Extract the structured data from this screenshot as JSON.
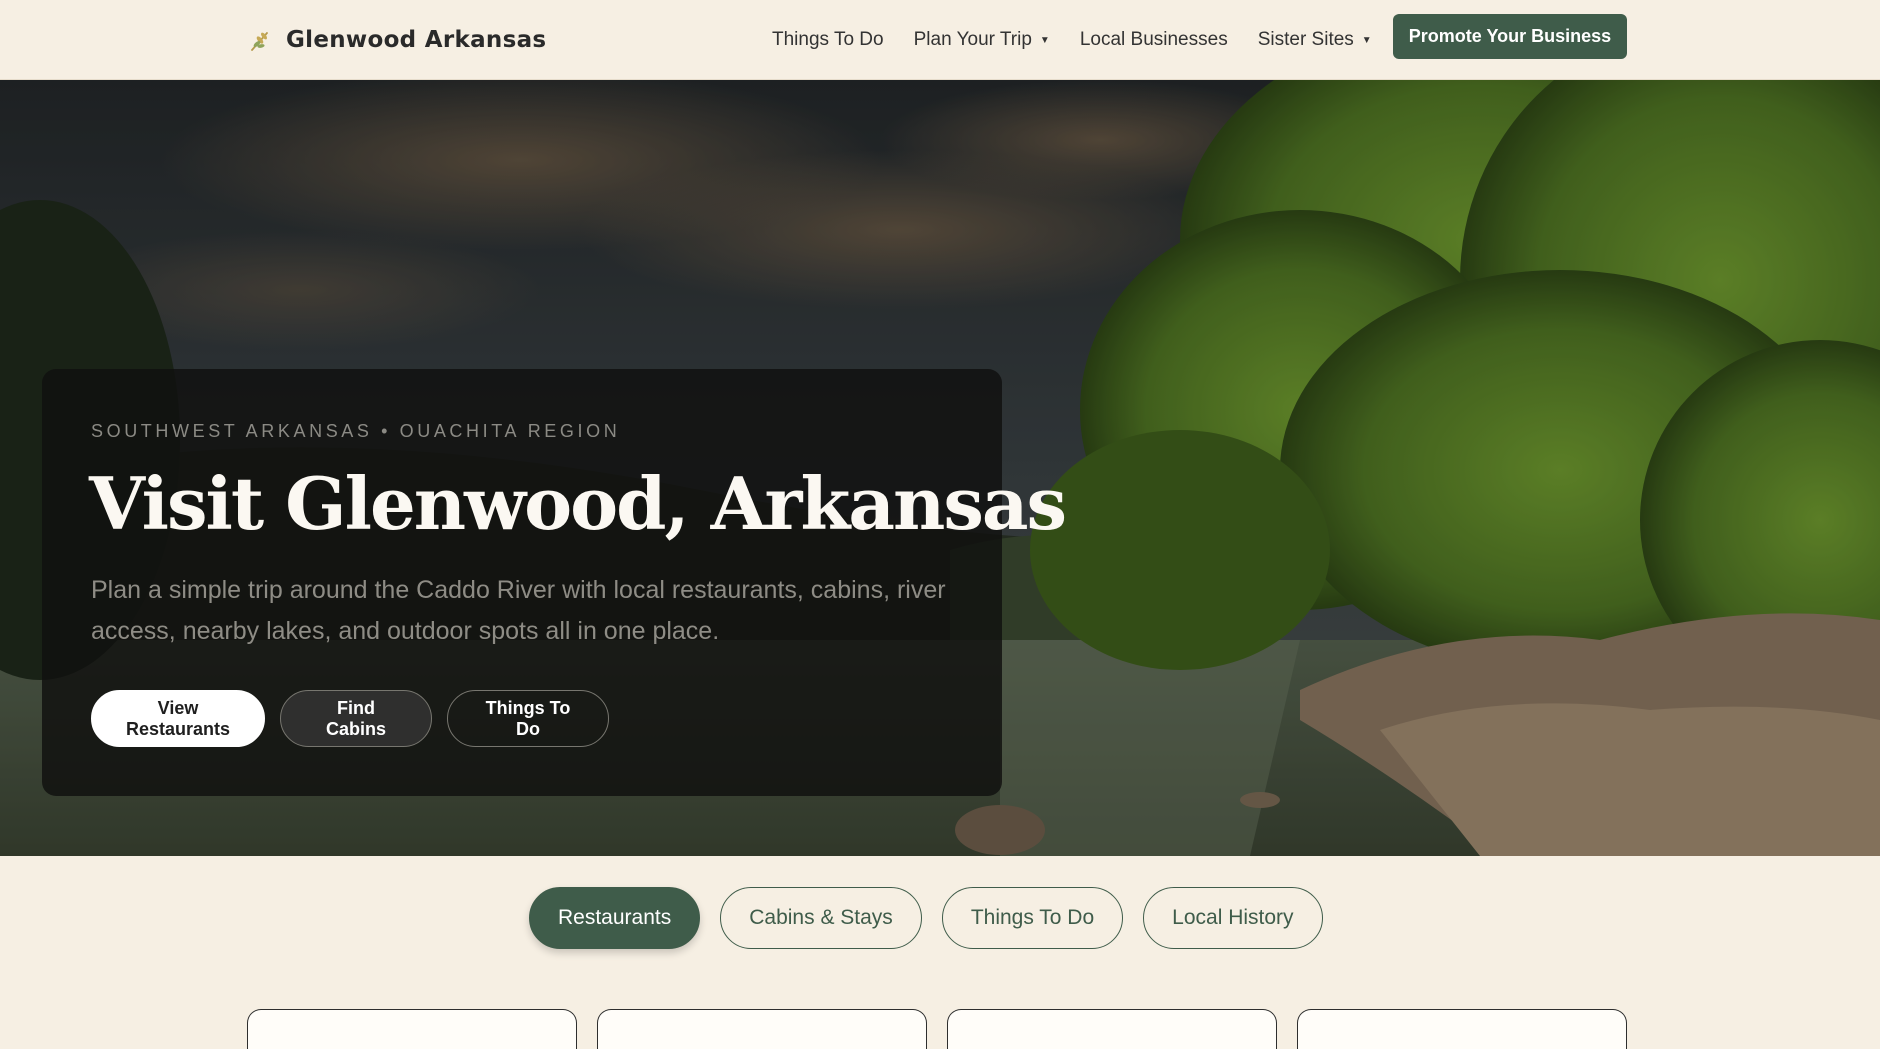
{
  "header": {
    "brand": "Glenwood Arkansas",
    "brand_icon": "wheat-icon",
    "nav": [
      {
        "label": "Things To Do",
        "has_dropdown": false
      },
      {
        "label": "Plan Your Trip",
        "has_dropdown": true
      },
      {
        "label": "Local Businesses",
        "has_dropdown": false
      },
      {
        "label": "Sister Sites",
        "has_dropdown": true
      }
    ],
    "cta_label": "Promote Your Business"
  },
  "hero": {
    "eyebrow": "SOUTHWEST ARKANSAS • OUACHITA REGION",
    "title": "Visit Glenwood, Arkansas",
    "description": "Plan a simple trip around the Caddo River with local restaurants, cabins, river access, nearby lakes, and outdoor spots all in one place.",
    "buttons": [
      "View Restaurants",
      "Find Cabins",
      "Things To Do"
    ]
  },
  "tabs": [
    {
      "label": "Restaurants",
      "active": true
    },
    {
      "label": "Cabins & Stays",
      "active": false
    },
    {
      "label": "Things To Do",
      "active": false
    },
    {
      "label": "Local History",
      "active": false
    }
  ],
  "colors": {
    "background": "#f6efe3",
    "accent": "#3f5c4a",
    "card_overlay": "#10100f"
  }
}
